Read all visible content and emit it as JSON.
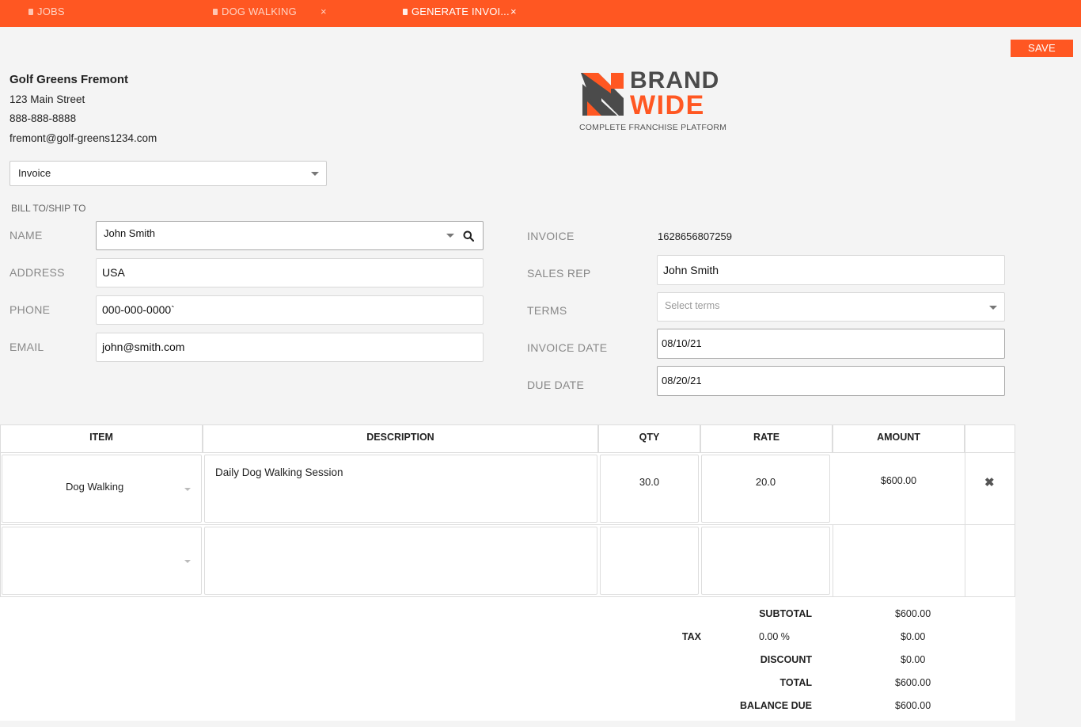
{
  "tabs": [
    {
      "label": "JOBS",
      "closable": false,
      "active": false
    },
    {
      "label": "DOG WALKING",
      "closable": true,
      "active": false
    },
    {
      "label": "GENERATE INVOI...",
      "closable": true,
      "active": true
    }
  ],
  "close_glyph": "×",
  "save_label": "SAVE",
  "company": {
    "name": "Golf Greens Fremont",
    "address": "123 Main Street",
    "phone": "888-888-8888",
    "email": "fremont@golf-greens1234.com"
  },
  "logo": {
    "line1": "BRAND",
    "line2": "WIDE",
    "tagline": "COMPLETE FRANCHISE PLATFORM",
    "colors": {
      "dark": "#4b4b4b",
      "accent": "#ff5722"
    }
  },
  "doc_type": {
    "selected": "Invoice"
  },
  "bill_to": {
    "section_label": "BILL TO/SHIP TO",
    "name_label": "NAME",
    "name_value": "John Smith",
    "address_label": "ADDRESS",
    "address_value": "USA",
    "phone_label": "PHONE",
    "phone_value": "000-000-0000`",
    "email_label": "EMAIL",
    "email_value": "john@smith.com"
  },
  "invoice_info": {
    "invoice_label": "INVOICE",
    "invoice_number": "1628656807259",
    "sales_rep_label": "SALES REP",
    "sales_rep_value": "John Smith",
    "terms_label": "TERMS",
    "terms_placeholder": "Select terms",
    "invoice_date_label": "INVOICE DATE",
    "invoice_date_value": "08/10/21",
    "due_date_label": "DUE DATE",
    "due_date_value": "08/20/21"
  },
  "table": {
    "headers": {
      "item": "ITEM",
      "description": "DESCRIPTION",
      "qty": "QTY",
      "rate": "RATE",
      "amount": "AMOUNT"
    },
    "rows": [
      {
        "item": "Dog Walking",
        "description": "Daily Dog Walking Session",
        "qty": "30.0",
        "rate": "20.0",
        "amount": "$600.00",
        "delete": "✖"
      },
      {
        "item": "",
        "description": "",
        "qty": "",
        "rate": "",
        "amount": "",
        "delete": ""
      }
    ]
  },
  "totals": {
    "subtotal_label": "SUBTOTAL",
    "subtotal_value": "$600.00",
    "tax_label": "TAX",
    "tax_rate": "0.00 %",
    "tax_value": "$0.00",
    "discount_label": "DISCOUNT",
    "discount_value": "$0.00",
    "total_label": "TOTAL",
    "total_value": "$600.00",
    "balance_label": "BALANCE DUE",
    "balance_value": "$600.00"
  },
  "icons": {
    "search": "search-icon",
    "delete": "close-icon",
    "dropdown": "chevron-down-icon",
    "tab_doc": "document-icon"
  },
  "colors": {
    "brand": "#ff5722",
    "background": "#f4f4f4"
  }
}
